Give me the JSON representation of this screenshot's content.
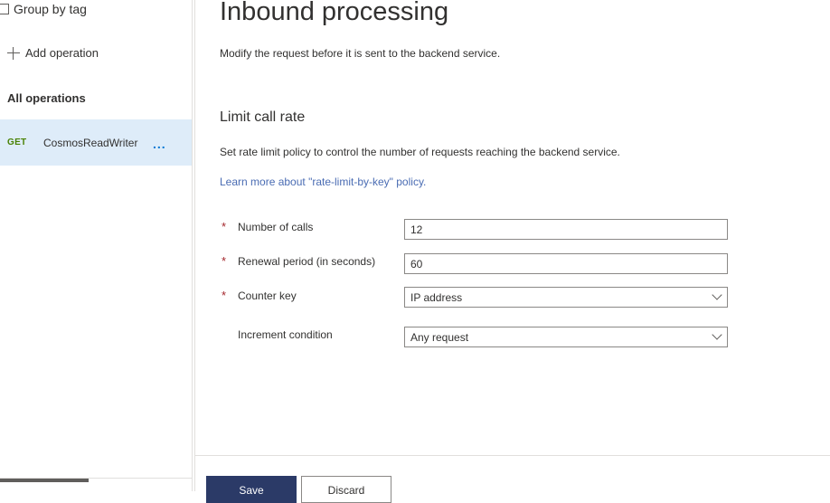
{
  "sidebar": {
    "group_by_tag_label": "Group by tag",
    "add_operation_label": "Add operation",
    "all_operations_label": "All operations",
    "operations": [
      {
        "method": "GET",
        "name": "CosmosReadWriter",
        "more": "..."
      }
    ]
  },
  "main": {
    "title": "Inbound processing",
    "subtitle": "Modify the request before it is sent to the backend service.",
    "section_title": "Limit call rate",
    "section_description": "Set rate limit policy to control the number of requests reaching the backend service.",
    "learn_more_link": "Learn more about \"rate-limit-by-key\" policy.",
    "required_marker": "*",
    "fields": {
      "number_of_calls": {
        "label": "Number of calls",
        "value": "12",
        "required": true
      },
      "renewal_period": {
        "label": "Renewal period (in seconds)",
        "value": "60",
        "required": true
      },
      "counter_key": {
        "label": "Counter key",
        "value": "IP address",
        "required": true
      },
      "increment_condition": {
        "label": "Increment condition",
        "value": "Any request",
        "required": false
      }
    }
  },
  "footer": {
    "save_label": "Save",
    "discard_label": "Discard"
  },
  "colors": {
    "accent": "#0078d4",
    "selected_row": "#deecf9",
    "get_method": "#498205",
    "required": "#a4262c",
    "link": "#4a6cb3",
    "save_button": "#2b3a67"
  }
}
